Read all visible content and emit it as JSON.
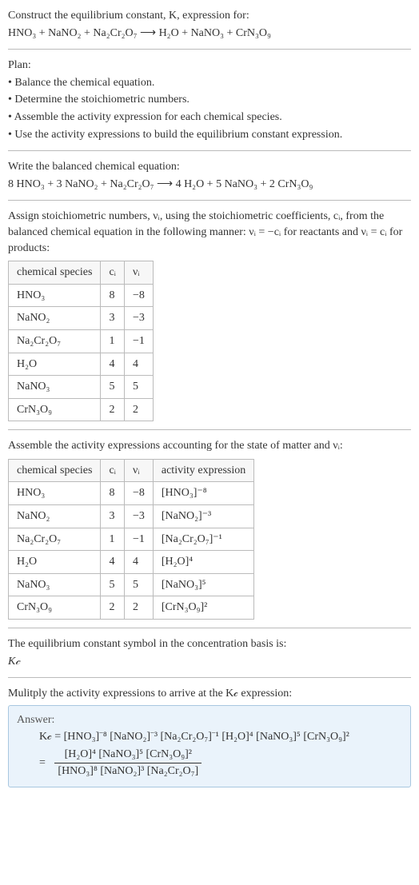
{
  "intro": {
    "line1": "Construct the equilibrium constant, K, expression for:",
    "equation": "HNO₃ + NaNO₂ + Na₂Cr₂O₇ ⟶ H₂O + NaNO₃ + CrN₃O₉"
  },
  "plan": {
    "heading": "Plan:",
    "items": [
      "• Balance the chemical equation.",
      "• Determine the stoichiometric numbers.",
      "• Assemble the activity expression for each chemical species.",
      "• Use the activity expressions to build the equilibrium constant expression."
    ]
  },
  "balanced": {
    "heading": "Write the balanced chemical equation:",
    "equation": "8 HNO₃ + 3 NaNO₂ + Na₂Cr₂O₇ ⟶ 4 H₂O + 5 NaNO₃ + 2 CrN₃O₉"
  },
  "assign": {
    "text": "Assign stoichiometric numbers, νᵢ, using the stoichiometric coefficients, cᵢ, from the balanced chemical equation in the following manner: νᵢ = −cᵢ for reactants and νᵢ = cᵢ for products:"
  },
  "table1": {
    "headers": [
      "chemical species",
      "cᵢ",
      "νᵢ"
    ],
    "rows": [
      [
        "HNO₃",
        "8",
        "−8"
      ],
      [
        "NaNO₂",
        "3",
        "−3"
      ],
      [
        "Na₂Cr₂O₇",
        "1",
        "−1"
      ],
      [
        "H₂O",
        "4",
        "4"
      ],
      [
        "NaNO₃",
        "5",
        "5"
      ],
      [
        "CrN₃O₉",
        "2",
        "2"
      ]
    ]
  },
  "assemble": {
    "text": "Assemble the activity expressions accounting for the state of matter and νᵢ:"
  },
  "table2": {
    "headers": [
      "chemical species",
      "cᵢ",
      "νᵢ",
      "activity expression"
    ],
    "rows": [
      [
        "HNO₃",
        "8",
        "−8",
        "[HNO₃]⁻⁸"
      ],
      [
        "NaNO₂",
        "3",
        "−3",
        "[NaNO₂]⁻³"
      ],
      [
        "Na₂Cr₂O₇",
        "1",
        "−1",
        "[Na₂Cr₂O₇]⁻¹"
      ],
      [
        "H₂O",
        "4",
        "4",
        "[H₂O]⁴"
      ],
      [
        "NaNO₃",
        "5",
        "5",
        "[NaNO₃]⁵"
      ],
      [
        "CrN₃O₉",
        "2",
        "2",
        "[CrN₃O₉]²"
      ]
    ]
  },
  "symbol": {
    "line1": "The equilibrium constant symbol in the concentration basis is:",
    "line2": "K𝒸"
  },
  "multiply": {
    "text": "Mulitply the activity expressions to arrive at the K𝒸 expression:"
  },
  "answer": {
    "label": "Answer:",
    "line1": "K𝒸 = [HNO₃]⁻⁸ [NaNO₂]⁻³ [Na₂Cr₂O₇]⁻¹ [H₂O]⁴ [NaNO₃]⁵ [CrN₃O₉]²",
    "eq": "=",
    "numerator": "[H₂O]⁴ [NaNO₃]⁵ [CrN₃O₉]²",
    "denominator": "[HNO₃]⁸ [NaNO₂]³ [Na₂Cr₂O₇]"
  },
  "chart_data": {
    "type": "table",
    "title": "Stoichiometric numbers and activity expressions",
    "tables": [
      {
        "columns": [
          "chemical species",
          "c_i",
          "nu_i"
        ],
        "rows": [
          {
            "chemical species": "HNO3",
            "c_i": 8,
            "nu_i": -8
          },
          {
            "chemical species": "NaNO2",
            "c_i": 3,
            "nu_i": -3
          },
          {
            "chemical species": "Na2Cr2O7",
            "c_i": 1,
            "nu_i": -1
          },
          {
            "chemical species": "H2O",
            "c_i": 4,
            "nu_i": 4
          },
          {
            "chemical species": "NaNO3",
            "c_i": 5,
            "nu_i": 5
          },
          {
            "chemical species": "CrN3O9",
            "c_i": 2,
            "nu_i": 2
          }
        ]
      },
      {
        "columns": [
          "chemical species",
          "c_i",
          "nu_i",
          "activity expression"
        ],
        "rows": [
          {
            "chemical species": "HNO3",
            "c_i": 8,
            "nu_i": -8,
            "activity expression": "[HNO3]^-8"
          },
          {
            "chemical species": "NaNO2",
            "c_i": 3,
            "nu_i": -3,
            "activity expression": "[NaNO2]^-3"
          },
          {
            "chemical species": "Na2Cr2O7",
            "c_i": 1,
            "nu_i": -1,
            "activity expression": "[Na2Cr2O7]^-1"
          },
          {
            "chemical species": "H2O",
            "c_i": 4,
            "nu_i": 4,
            "activity expression": "[H2O]^4"
          },
          {
            "chemical species": "NaNO3",
            "c_i": 5,
            "nu_i": 5,
            "activity expression": "[NaNO3]^5"
          },
          {
            "chemical species": "CrN3O9",
            "c_i": 2,
            "nu_i": 2,
            "activity expression": "[CrN3O9]^2"
          }
        ]
      }
    ]
  }
}
